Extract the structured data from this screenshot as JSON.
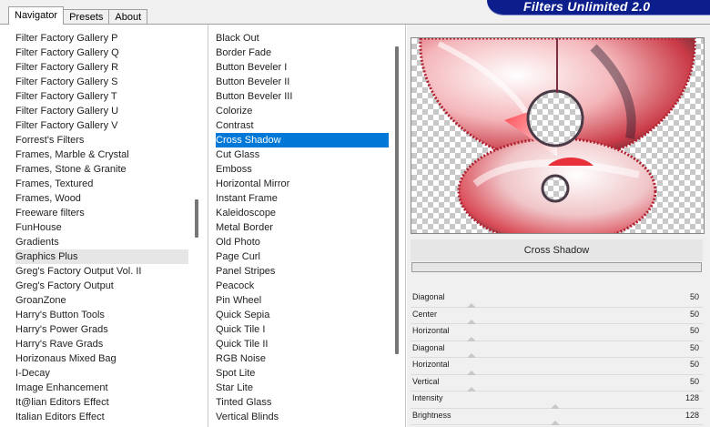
{
  "tabs": [
    {
      "label": "Navigator",
      "active": true
    },
    {
      "label": "Presets",
      "active": false
    },
    {
      "label": "About",
      "active": false
    }
  ],
  "brand": "Filters Unlimited 2.0",
  "categories": [
    "Filter Factory Gallery P",
    "Filter Factory Gallery Q",
    "Filter Factory Gallery R",
    "Filter Factory Gallery S",
    "Filter Factory Gallery T",
    "Filter Factory Gallery U",
    "Filter Factory Gallery V",
    "Forrest's Filters",
    "Frames, Marble & Crystal",
    "Frames, Stone & Granite",
    "Frames, Textured",
    "Frames, Wood",
    "Freeware filters",
    "FunHouse",
    "Gradients",
    "Graphics Plus",
    "Greg's Factory Output Vol. II",
    "Greg's Factory Output",
    "GroanZone",
    "Harry's Button Tools",
    "Harry's Power Grads",
    "Harry's Rave Grads",
    "Horizonaus Mixed Bag",
    "I-Decay",
    "Image Enhancement",
    "It@lian Editors Effect",
    "Italian Editors Effect"
  ],
  "selected_category": "Graphics Plus",
  "filters": [
    "Black Out",
    "Border Fade",
    "Button Beveler I",
    "Button Beveler II",
    "Button Beveler III",
    "Colorize",
    "Contrast",
    "Cross Shadow",
    "Cut Glass",
    "Emboss",
    "Horizontal Mirror",
    "Instant Frame",
    "Kaleidoscope",
    "Metal Border",
    "Old Photo",
    "Page Curl",
    "Panel Stripes",
    "Peacock",
    "Pin Wheel",
    "Quick Sepia",
    "Quick Tile I",
    "Quick Tile II",
    "RGB Noise",
    "Spot Lite",
    "Star Lite",
    "Tinted Glass",
    "Vertical Blinds"
  ],
  "selected_filter": "Cross Shadow",
  "preview_title": "Cross Shadow",
  "params": [
    {
      "label": "Diagonal",
      "value": "50"
    },
    {
      "label": "Center",
      "value": "50"
    },
    {
      "label": "Horizontal",
      "value": "50"
    },
    {
      "label": "Diagonal",
      "value": "50"
    },
    {
      "label": "Horizontal",
      "value": "50"
    },
    {
      "label": "Vertical",
      "value": "50"
    },
    {
      "label": "Intensity",
      "value": "128"
    },
    {
      "label": "Brightness",
      "value": "128"
    }
  ],
  "colors": {
    "brand_bg": "#0b1e8c",
    "selection": "#0078d7",
    "preview_accent": "#e8313a"
  }
}
